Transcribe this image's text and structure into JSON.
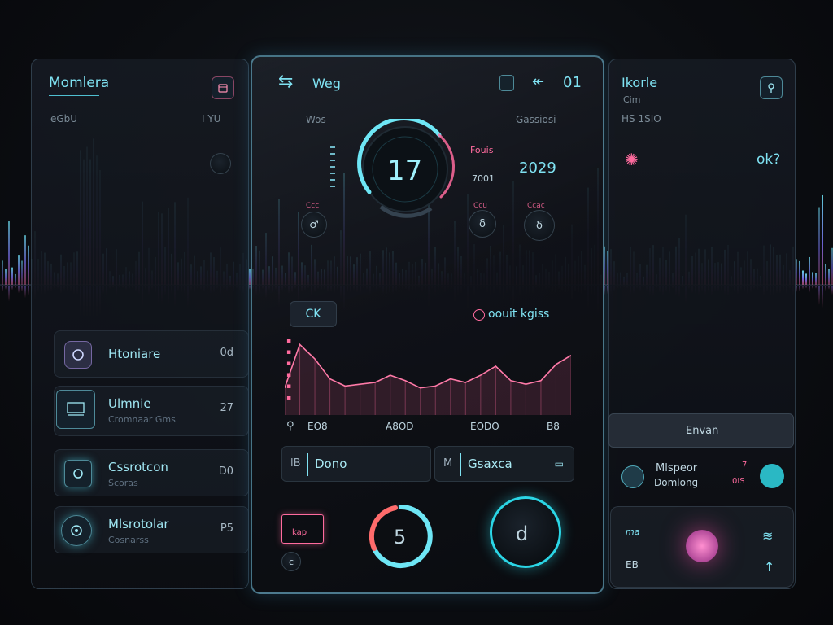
{
  "colors": {
    "cyan": "#7fe2f2",
    "pink": "#ff6b9e",
    "purple": "#8a6cf0",
    "bg": "#0b0d11"
  },
  "left": {
    "title": "Momlera",
    "subtitle": "eGbU",
    "time_readout": "I YU",
    "icon_top_right": "calendar-icon",
    "rows": [
      {
        "title": "Htoniare",
        "sub": "",
        "value": "0d",
        "icon": "face-icon"
      },
      {
        "title": "Ulmnie",
        "sub": "Cromnaar Gms",
        "value": "27",
        "icon": "screen-icon"
      },
      {
        "title": "Cssrotcon",
        "sub": "Scoras",
        "value": "D0",
        "icon": "chat-icon"
      },
      {
        "title": "Mlsrotolar",
        "sub": "Cosnarss",
        "value": "P5",
        "icon": "target-icon"
      }
    ]
  },
  "center": {
    "back_label": "Weg",
    "header_icons": [
      "battery-icon",
      "forward-icon",
      "clock-icon"
    ],
    "header_value": "01",
    "left_caption": "Wos",
    "right_caption": "Gassiosi",
    "dial_value": "17",
    "stat_small_1": "Fouis",
    "stat_small_2": "7001",
    "stat_value": "2029",
    "knob_caption_left": "Ccc",
    "knob_caption_right_1": "Ccu",
    "knob_caption_right_2": "Ccac",
    "ok_button": "CK",
    "legend_label": "oouit kgiss",
    "axis_labels": [
      "EO8",
      "A8OD",
      "EODO",
      "B8"
    ],
    "field1_label": "Dono",
    "field1_prefix": "lB",
    "field2_label": "Gsaxca",
    "field2_prefix": "M",
    "ring_value": "5",
    "knob_value": "d",
    "sticker_label": "kap"
  },
  "right": {
    "title": "Ikorle",
    "sub1": "Cim",
    "sub2": "HS 1SIO",
    "stat_value": "ok?",
    "bar_label": "Envan",
    "row_title": "Mlspeor",
    "row_sub": "Domlong",
    "row_value_1": "7",
    "row_value_2": "0IS",
    "bottom_label_1": "ma",
    "bottom_label_2": "EB"
  },
  "chart_data": {
    "type": "area",
    "title": "",
    "x": [
      1,
      2,
      3,
      4,
      5,
      6,
      7,
      8,
      9,
      10,
      11,
      12,
      13,
      14,
      15,
      16,
      17,
      18,
      19,
      20
    ],
    "series": [
      {
        "values": [
          30,
          78,
          62,
          40,
          32,
          34,
          36,
          44,
          38,
          30,
          32,
          40,
          36,
          44,
          54,
          38,
          34,
          38,
          56,
          66
        ]
      }
    ],
    "xlabel": "",
    "ylabel": "",
    "grid": false
  }
}
